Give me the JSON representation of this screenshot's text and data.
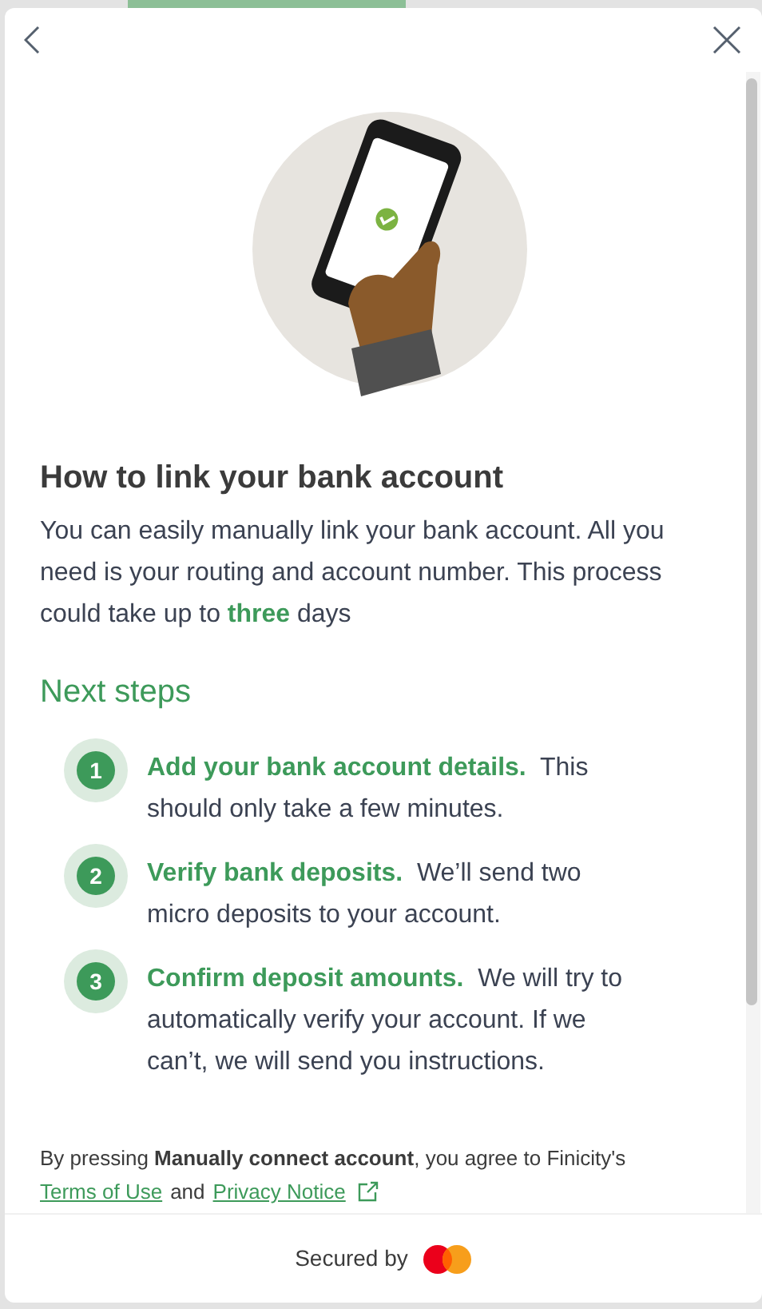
{
  "title": "How to link your bank account",
  "description": "You can easily manually link your bank account. All you need is your routing and account number. This process could take up to **three** days",
  "next_steps": {
    "heading": "Next steps",
    "steps": [
      {
        "number": "1",
        "text": "**Add your bank account details.**  This should only take a few minutes."
      },
      {
        "number": "2",
        "text": "**Verify bank deposits.**  We’ll send two micro deposits to your account."
      },
      {
        "number": "3",
        "text": "**Confirm deposit amounts.**  We will try to automatically verify your account. If we can’t, we will send you instructions."
      }
    ]
  },
  "disclaimer": {
    "text": "By pressing **Manually connect account**, you agree to Finicity's",
    "links": [
      "Terms of Use",
      "Privacy Notice"
    ],
    "joiner": "and"
  },
  "footer": {
    "label": "Secured by"
  }
}
